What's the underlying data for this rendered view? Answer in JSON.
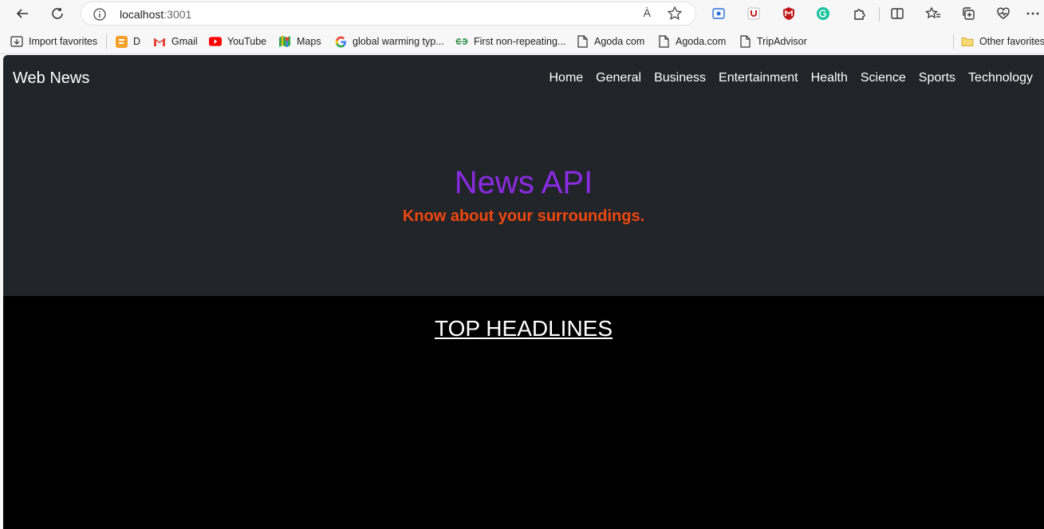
{
  "browser": {
    "url_host": "localhost",
    "url_port": ":3001",
    "read_aloud_label": "À",
    "bookmarks": [
      {
        "label": "Import favorites",
        "icon": "import-icon"
      },
      {
        "label": "D",
        "icon": "blogger-icon"
      },
      {
        "label": "Gmail",
        "icon": "gmail-icon"
      },
      {
        "label": "YouTube",
        "icon": "youtube-icon"
      },
      {
        "label": "Maps",
        "icon": "maps-icon"
      },
      {
        "label": "global warming typ...",
        "icon": "google-icon"
      },
      {
        "label": "First non-repeating...",
        "icon": "geeksforgeeks-icon"
      },
      {
        "label": "Agoda com",
        "icon": "page-icon"
      },
      {
        "label": "Agoda.com",
        "icon": "page-icon"
      },
      {
        "label": "TripAdvisor",
        "icon": "page-icon"
      }
    ],
    "other_favorites": "Other favorites"
  },
  "site": {
    "brand": "Web News",
    "nav": [
      "Home",
      "General",
      "Business",
      "Entertainment",
      "Health",
      "Science",
      "Sports",
      "Technology"
    ],
    "hero_title": "News API",
    "hero_subtitle": "Know about your surroundings.",
    "section_title": "TOP HEADLINES"
  },
  "colors": {
    "navbar_bg": "#212529",
    "hero_title": "#8a2be2",
    "hero_subtitle": "#f0460e",
    "page_bg": "#000000"
  }
}
